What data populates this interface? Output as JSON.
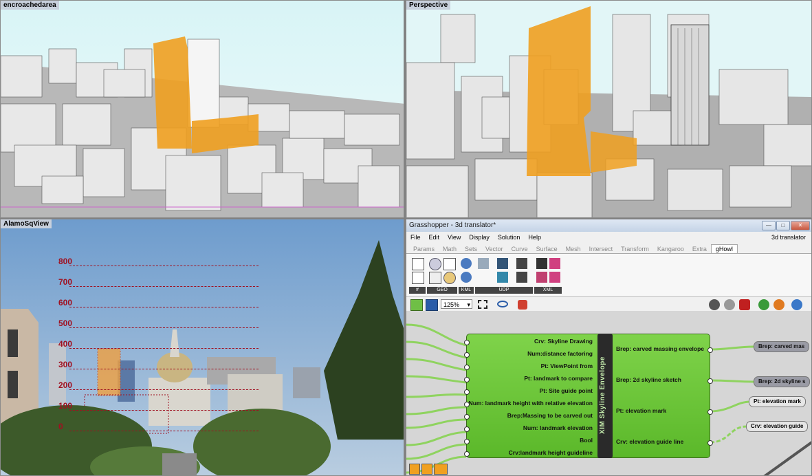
{
  "viewports": {
    "top_left": {
      "label": "encroachedarea"
    },
    "top_right": {
      "label": "Perspective"
    },
    "bottom_left": {
      "label": "AlamoSqView"
    }
  },
  "elevation_marks": [
    "800",
    "700",
    "600",
    "500",
    "400",
    "300",
    "200",
    "100",
    "0"
  ],
  "grasshopper": {
    "title": "Grasshopper - 3d translator*",
    "document_name": "3d translator",
    "menu": [
      "File",
      "Edit",
      "View",
      "Display",
      "Solution",
      "Help"
    ],
    "tabs": [
      "Params",
      "Math",
      "Sets",
      "Vector",
      "Curve",
      "Surface",
      "Mesh",
      "Intersect",
      "Transform",
      "Kangaroo",
      "Extra",
      "gHowl"
    ],
    "active_tab": "gHowl",
    "ribbon_groups": [
      "#",
      "GEO",
      "KML",
      "UDP",
      "XML"
    ],
    "zoom": "125%",
    "component": {
      "title": "XIM Skyline Envelope",
      "inputs": [
        "Crv: Skyline Drawing",
        "Num:distance  factoring",
        "Pt: ViewPoint from",
        "Pt: landmark to compare",
        "Pt: Site guide point",
        "Num: landmark height with relative elevation",
        "Brep:Massing to be carved out",
        "Num: landmark elevation",
        "Bool",
        "Crv:landmark height guideline"
      ],
      "outputs": [
        "Brep: carved massing envelope",
        "Brep: 2d skyline sketch",
        "Pt: elevation mark",
        "Crv: elevation guide line"
      ]
    },
    "params": [
      "Brep: carved mas",
      "Brep: 2d skyline s",
      "Pt: elevation mark",
      "Crv: elevation guide"
    ],
    "colors": {
      "component": "#6cc738",
      "wire": "#8fd35f",
      "massing": "#f0a020"
    }
  }
}
